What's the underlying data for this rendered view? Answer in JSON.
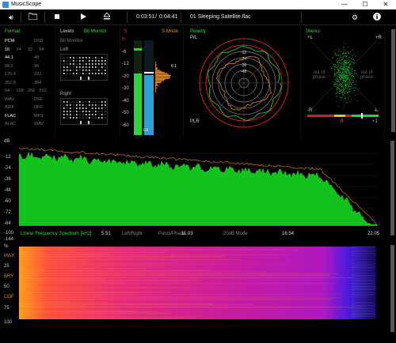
{
  "window": {
    "title": "MusicScope"
  },
  "toolbar": {
    "elapsed": "0:03:51",
    "separator": "/",
    "total": "0:04:41",
    "track": "01 Sleeping Satellite.flac"
  },
  "format": {
    "title": "Format",
    "rows": [
      [
        "PCM",
        "DSD"
      ],
      [
        "16",
        "24",
        "32",
        "64"
      ],
      [
        "44.1",
        "48"
      ],
      [
        "88.2",
        "96"
      ],
      [
        "176.4",
        "192"
      ],
      [
        "352.8",
        "384"
      ],
      [
        "64",
        "128",
        "256",
        "512"
      ],
      [
        "WAV",
        "DSF"
      ],
      [
        "AIFF",
        "DFF"
      ],
      [
        "FLAC",
        "MP3"
      ],
      [
        "ALAC",
        "WAV"
      ]
    ],
    "active": [
      "PCM",
      "16",
      "44.1",
      "FLAC"
    ]
  },
  "levels": {
    "title": "Levels",
    "bit_monitor_title": "Bit Monitor",
    "left_label": "Left",
    "right_label": "Right",
    "scale": [
      "0",
      "-6",
      "-12",
      "-20",
      "-30",
      "-40",
      "-50",
      "-60"
    ],
    "channel_labels": [
      "LL",
      "LU"
    ],
    "peak": "6.1",
    "smode": "S-Mode"
  },
  "polarity": {
    "title": "Polarity",
    "pl_label": "P/L",
    "plr_label": "PLR",
    "rings": [
      "-12",
      "-24",
      "-36",
      "-48"
    ]
  },
  "stereo": {
    "title": "Stereo",
    "l_label": "+L",
    "r_label": "+R",
    "neg_l": "-L",
    "neg_r": "-R",
    "out_of_phase": "out of phase",
    "meter_min": "-1",
    "meter_mid": "0",
    "meter_max": "+1"
  },
  "spectrum": {
    "db_ticks": [
      "dB",
      "-12",
      "-24",
      "-36",
      "-48",
      "-60",
      "-72",
      "-84",
      "-100",
      "-144"
    ],
    "caption": "Linear Frequency Spectrum [kHz]",
    "mode1": "Left/Right",
    "mode2": "Pan/s/Phase",
    "mode3": "-20dB Mode",
    "freq_ticks": [
      "5.51",
      "11.03",
      "16.54",
      "22.05"
    ]
  },
  "spectrogram": {
    "left_ticks": [
      "%",
      "MAX",
      "25",
      "BRY",
      "50",
      "COF",
      "75",
      "100"
    ]
  },
  "colors": {
    "accent_green": "#2bd43a",
    "accent_orange": "#e08a22",
    "accent_red": "#e03333",
    "meter_blue": "#2b9fd6"
  }
}
